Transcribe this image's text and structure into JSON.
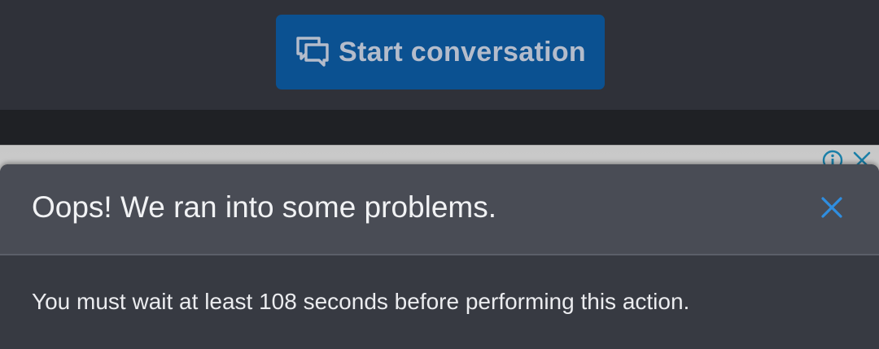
{
  "header": {
    "start_conversation_label": "Start conversation",
    "start_conversation_icon": "chat-bubbles-icon"
  },
  "ad": {
    "info_icon": "info-icon",
    "close_icon": "close-icon"
  },
  "error_dialog": {
    "title": "Oops! We ran into some problems.",
    "message": "You must wait at least 108 seconds before performing this action.",
    "close_icon": "close-icon"
  },
  "colors": {
    "accent": "#0b5191",
    "close_x": "#2f8ee0",
    "ad_icons": "#1a7fa8"
  }
}
